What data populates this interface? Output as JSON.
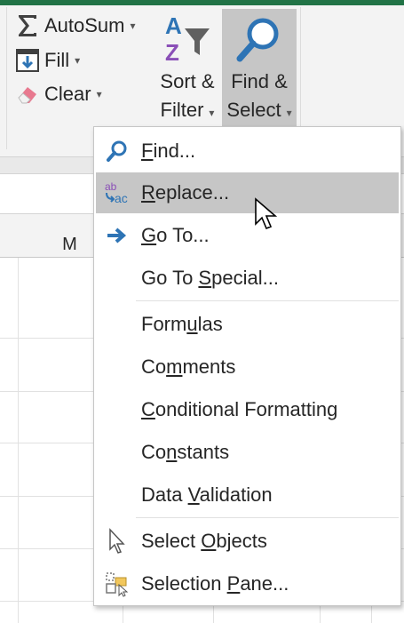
{
  "ribbon": {
    "autosum": {
      "label": "AutoSum",
      "icon": "sigma-icon"
    },
    "fill": {
      "label": "Fill",
      "icon": "fill-down-icon"
    },
    "clear": {
      "label": "Clear",
      "icon": "eraser-icon"
    },
    "sort_filter": {
      "line1": "Sort &",
      "line2": "Filter",
      "icon": "sort-filter-icon"
    },
    "find_select": {
      "line1": "Find &",
      "line2": "Select",
      "icon": "magnifier-icon"
    }
  },
  "sheet": {
    "visible_column": "M"
  },
  "menu": {
    "items": [
      {
        "label": "Find...",
        "accel": "F",
        "icon": "binoculars-find-icon",
        "highlighted": false
      },
      {
        "label": "Replace...",
        "accel": "R",
        "icon": "replace-abc-icon",
        "highlighted": true
      },
      {
        "label": "Go To...",
        "accel": "G",
        "icon": "goto-arrow-icon",
        "highlighted": false
      },
      {
        "label": "Go To Special...",
        "accel": "S",
        "icon": "",
        "highlighted": false
      },
      {
        "label": "Formulas",
        "accel": "u",
        "icon": "",
        "highlighted": false
      },
      {
        "label": "Comments",
        "accel": "m",
        "icon": "",
        "highlighted": false
      },
      {
        "label": "Conditional Formatting",
        "accel": "C",
        "icon": "",
        "highlighted": false
      },
      {
        "label": "Constants",
        "accel": "n",
        "icon": "",
        "highlighted": false
      },
      {
        "label": "Data Validation",
        "accel": "V",
        "icon": "",
        "highlighted": false
      },
      {
        "label": "Select Objects",
        "accel": "O",
        "icon": "select-objects-cursor-icon",
        "highlighted": false
      },
      {
        "label": "Selection Pane...",
        "accel": "P",
        "icon": "selection-pane-icon",
        "highlighted": false
      }
    ]
  },
  "colors": {
    "accent_green": "#217346",
    "highlight": "#c6c6c6",
    "icon_blue": "#2e74b5",
    "icon_purple": "#8a4fb7"
  }
}
